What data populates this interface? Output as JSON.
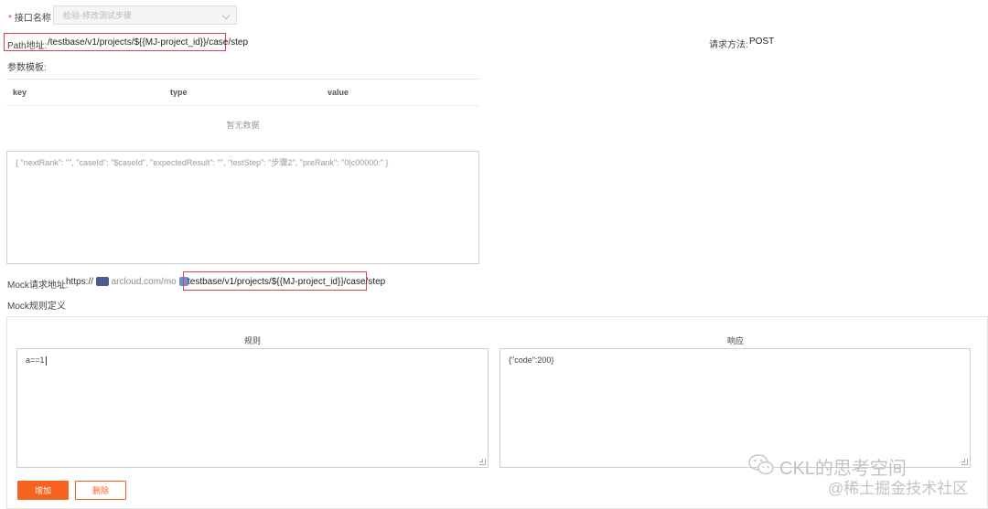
{
  "form": {
    "api_name_label": "接口名称",
    "api_name_value": "检验-修改测试步骤",
    "path_label": "Path地址:",
    "path_value": "/testbase/v1/projects/${{MJ-project_id}}/case/step",
    "method_label": "请求方法:",
    "method_value": "POST",
    "param_template_label": "参数模板:"
  },
  "param_table": {
    "columns": [
      "key",
      "type",
      "value"
    ],
    "empty_text": "暂无数据"
  },
  "body_textarea": {
    "value": "{ \"nextRank\": \"\", \"caseId\": \"$caseId\", \"expectedResult\": \"\", \"testStep\": \"步骤2\", \"preRank\": \"0|c00000:\" }"
  },
  "mock": {
    "address_label": "Mock请求地址:",
    "address_prefix": "https://",
    "address_mid": "arcloud.com/mo",
    "address_path": "testbase/v1/projects/${{MJ-project_id}}/case/step",
    "rules_label": "Mock规则定义",
    "rule_col_title": "规则",
    "response_col_title": "响应",
    "rule_value": "a==1",
    "response_value": "{\"code\":200}"
  },
  "buttons": {
    "add_label": "增加",
    "delete_label": "删除"
  },
  "watermark": {
    "line1": "CKL的思考空间",
    "line2": "@稀土掘金技术社区"
  },
  "colors": {
    "accent": "#f5631f",
    "highlight_border": "#d9454b"
  }
}
